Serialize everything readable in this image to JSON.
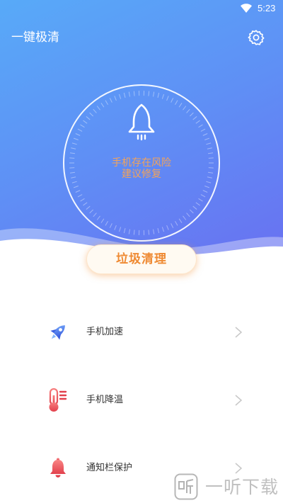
{
  "status_bar": {
    "time": "5:23",
    "wifi_icon": "wifi-icon"
  },
  "header": {
    "title": "一键极清",
    "settings_icon": "gear-icon"
  },
  "dial": {
    "icon": "rocket-outline-icon",
    "status_line1": "手机存在风险",
    "status_line2": "建议修复"
  },
  "primary_action": {
    "label": "垃圾清理"
  },
  "features": [
    {
      "label": "手机加速",
      "icon": "rocket-icon"
    },
    {
      "label": "手机降温",
      "icon": "thermometer-icon"
    },
    {
      "label": "通知栏保护",
      "icon": "bell-icon"
    }
  ],
  "watermark": {
    "text": "一听下载",
    "logo_icon": "yiting-logo-icon"
  },
  "colors": {
    "hero_start": "#58aaf8",
    "hero_end": "#6a6df1",
    "accent": "#f2a35a",
    "button_text": "#ef8a33",
    "speed_blue": "#3c5fe0",
    "alert_red": "#e2404c"
  }
}
